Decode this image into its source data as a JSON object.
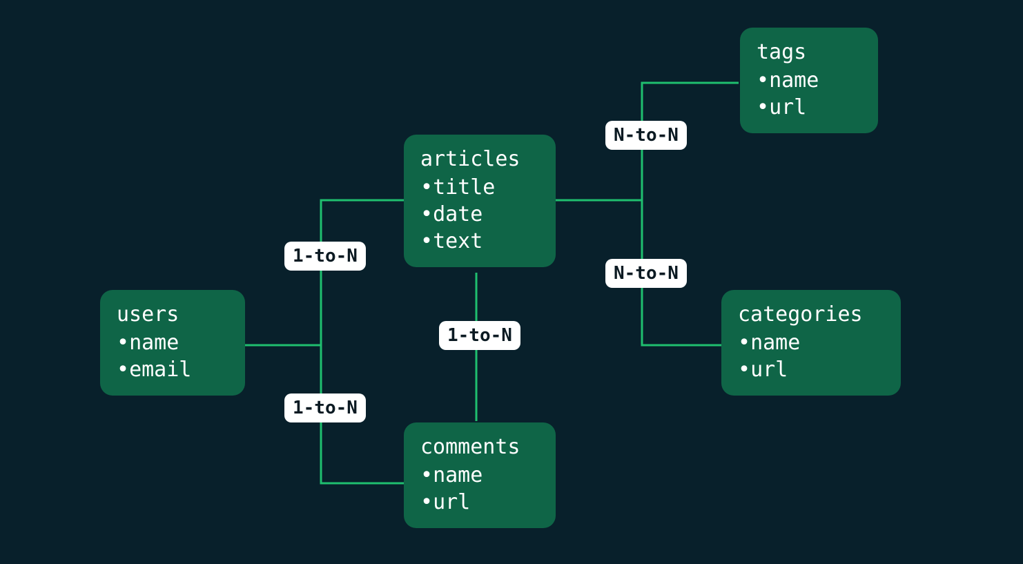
{
  "entities": {
    "users": {
      "title": "users",
      "fields": [
        "name",
        "email"
      ]
    },
    "articles": {
      "title": "articles",
      "fields": [
        "title",
        "date",
        "text"
      ]
    },
    "comments": {
      "title": "comments",
      "fields": [
        "name",
        "url"
      ]
    },
    "tags": {
      "title": "tags",
      "fields": [
        "name",
        "url"
      ]
    },
    "categories": {
      "title": "categories",
      "fields": [
        "name",
        "url"
      ]
    }
  },
  "relations": {
    "users_articles": "1-to-N",
    "users_comments": "1-to-N",
    "articles_comments": "1-to-N",
    "articles_tags": "N-to-N",
    "articles_categories": "N-to-N"
  },
  "bullet": "•",
  "colors": {
    "bg": "#08202b",
    "box": "#0f6547",
    "wire": "#1fbf6f",
    "label_bg": "#ffffff",
    "label_fg": "#0b1a22",
    "text": "#ffffff"
  }
}
